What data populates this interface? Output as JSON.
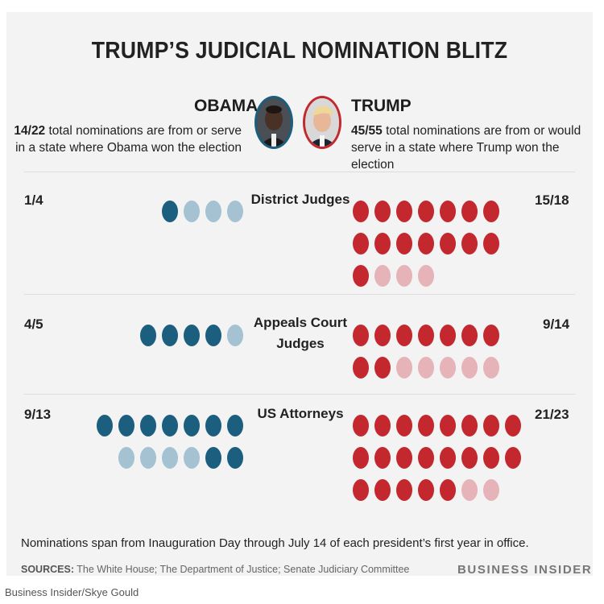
{
  "title": "TRUMP’S JUDICIAL NOMINATION BLITZ",
  "obama": {
    "name": "OBAMA",
    "fraction": "14/22",
    "desc_line1_rest": " total nominations are from or serve",
    "desc_line2": "in a state where Obama won the election"
  },
  "trump": {
    "name": "TRUMP",
    "fraction": "45/55",
    "desc_line1_rest": " total nominations are from or would",
    "desc_line2": "serve in a state where Trump won the election"
  },
  "chart_data": {
    "type": "dot-matrix",
    "colors": {
      "obama_in_state": "#1b5e7d",
      "obama_other": "#a4c2d1",
      "trump_in_state": "#c3282f",
      "trump_other": "#e5b3b8"
    },
    "categories": [
      {
        "label_line1": "District Judges",
        "label_line2": "",
        "obama_label": "1/4",
        "obama_in": 1,
        "obama_total": 4,
        "trump_label": "15/18",
        "trump_in": 15,
        "trump_total": 18
      },
      {
        "label_line1": "Appeals Court",
        "label_line2": "Judges",
        "obama_label": "4/5",
        "obama_in": 4,
        "obama_total": 5,
        "trump_label": "9/14",
        "trump_in": 9,
        "trump_total": 14
      },
      {
        "label_line1": "US Attorneys",
        "label_line2": "",
        "obama_label": "9/13",
        "obama_in": 9,
        "obama_total": 13,
        "trump_label": "21/23",
        "trump_in": 21,
        "trump_total": 23
      }
    ]
  },
  "footnote": "Nominations span from Inauguration Day through July 14 of each president’s first year in office.",
  "sources_label": "SOURCES:",
  "sources_text": " The White House; The Department of Justice; Senate Judiciary Committee",
  "brand": "BUSINESS INSIDER",
  "credit": "Business Insider/Skye Gould",
  "icons": {
    "obama_photo": "obama-portrait-icon",
    "trump_photo": "trump-portrait-icon"
  }
}
